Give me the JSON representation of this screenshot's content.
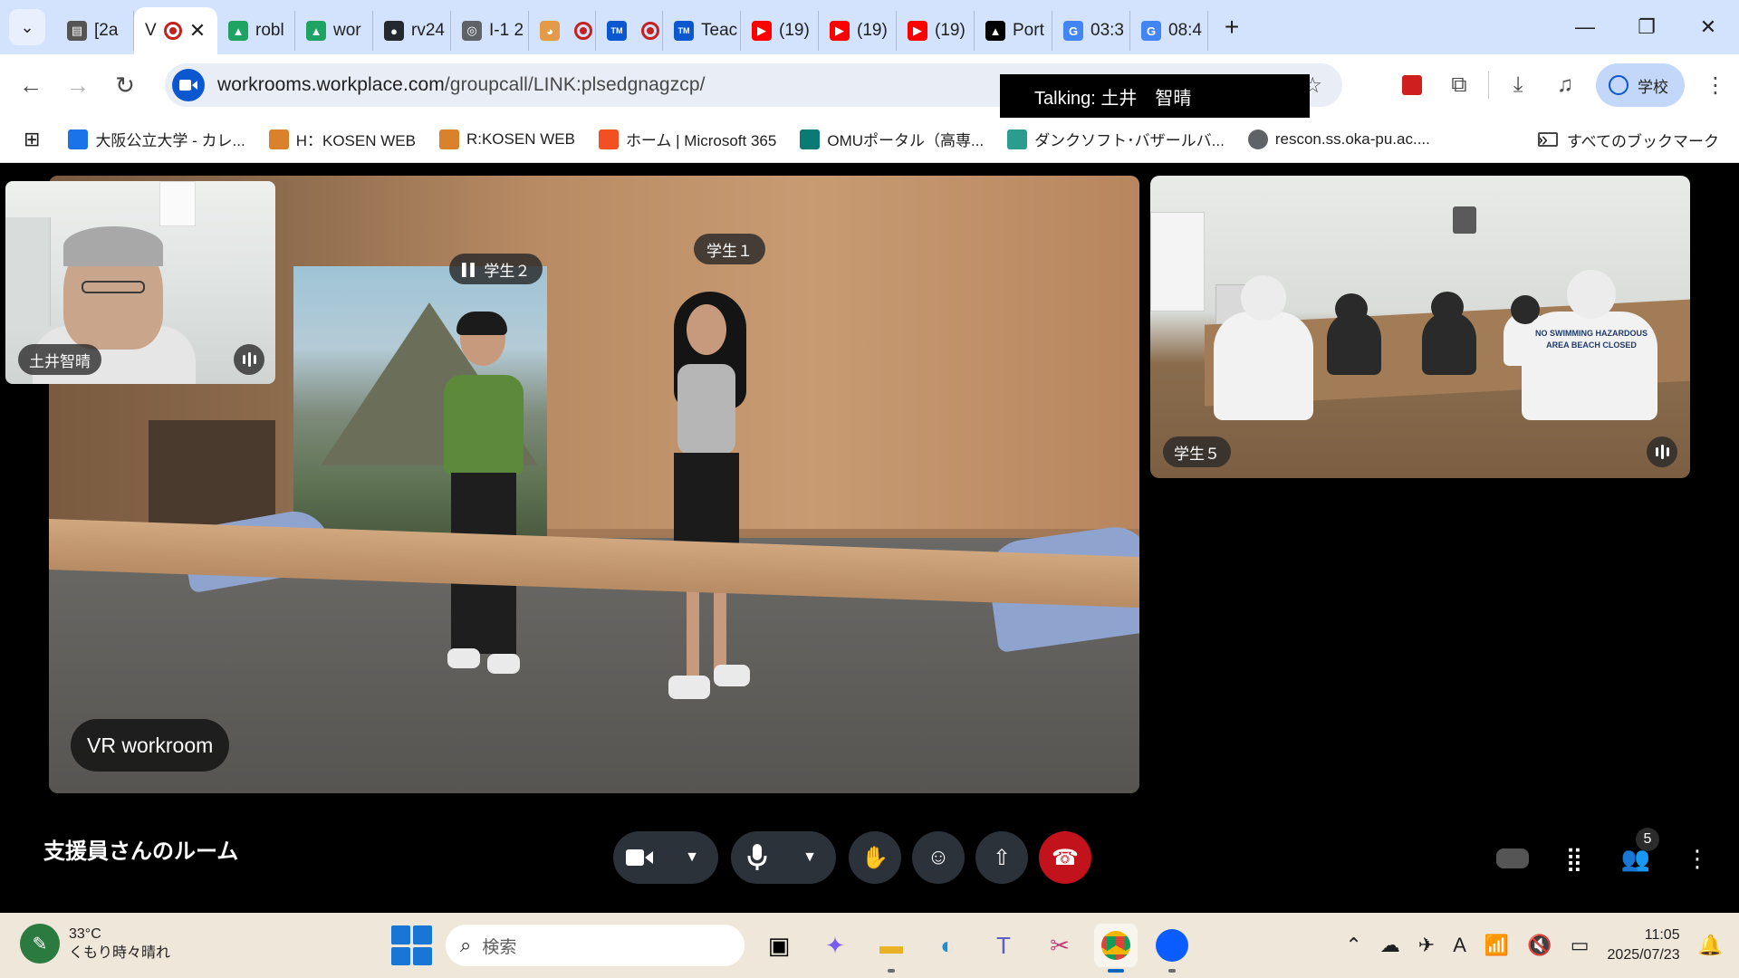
{
  "browser": {
    "tabs": [
      {
        "title": "[2a",
        "icon": "document-icon",
        "active": false
      },
      {
        "title": "V",
        "icon": "record-icon",
        "active": true
      },
      {
        "title": "robl",
        "icon": "drive-icon",
        "active": false
      },
      {
        "title": "wor",
        "icon": "drive-icon",
        "active": false
      },
      {
        "title": "rv24",
        "icon": "github-icon",
        "active": false
      },
      {
        "title": "I-1 2",
        "icon": "globe-icon",
        "active": false
      },
      {
        "title": "",
        "icon": "shiba-icon",
        "active": false
      },
      {
        "title": "",
        "icon": "tm-icon",
        "active": false
      },
      {
        "title": "Teac",
        "icon": "tm-icon",
        "active": false
      },
      {
        "title": "(19)",
        "icon": "youtube-icon",
        "active": false
      },
      {
        "title": "(19)",
        "icon": "youtube-icon",
        "active": false
      },
      {
        "title": "(19)",
        "icon": "youtube-icon",
        "active": false
      },
      {
        "title": "Port",
        "icon": "triangle-icon",
        "active": false
      },
      {
        "title": "03:3",
        "icon": "google-icon",
        "active": false
      },
      {
        "title": "08:4",
        "icon": "google-icon",
        "active": false
      }
    ],
    "url_host": "workrooms.workplace.com",
    "url_path": "/groupcall/LINK:plsedgnagzcp/",
    "profile_label": "学校",
    "tooltip": "Talking: 土井　智晴"
  },
  "bookmarks": [
    {
      "label": "大阪公立大学 - カレ...",
      "icon": "calendar-icon"
    },
    {
      "label": "H：KOSEN WEB",
      "icon": "people-icon"
    },
    {
      "label": "R:KOSEN WEB",
      "icon": "people-icon"
    },
    {
      "label": "ホーム | Microsoft 365",
      "icon": "microsoft-icon"
    },
    {
      "label": "OMUポータル（高専...",
      "icon": "sharepoint-icon"
    },
    {
      "label": "ダンクソフト･バザールバ...",
      "icon": "building-icon"
    },
    {
      "label": "rescon.ss.oka-pu.ac....",
      "icon": "globe-icon"
    }
  ],
  "bookmarks_all": "すべてのブックマーク",
  "call": {
    "main_label": "VR workroom",
    "avatar1_tag": "学生１",
    "avatar2_tag": "学生２",
    "pip_name": "土井智晴",
    "side_name": "学生５",
    "room_title": "支援員さんのルーム",
    "participant_count": "5",
    "shirt_text": "NO SWIMMING HAZARDOUS AREA BEACH CLOSED"
  },
  "taskbar": {
    "temperature": "33°C",
    "weather": "くもり時々晴れ",
    "search_placeholder": "検索",
    "time": "11:05",
    "date": "2025/07/23"
  },
  "colors": {
    "tabstrip": "#d3e3fd",
    "end_call": "#c2121c",
    "accent": "#0b57d0"
  }
}
